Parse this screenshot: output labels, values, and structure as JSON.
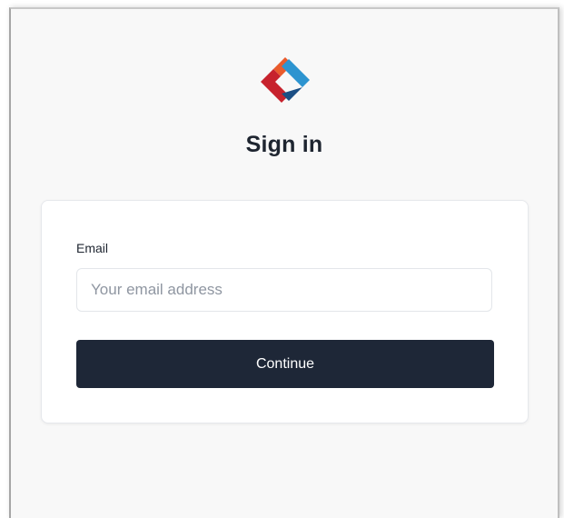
{
  "page": {
    "title": "Sign in"
  },
  "logo": {
    "icon": "brand-logo-icon",
    "colors": {
      "orange": "#e95b2c",
      "red": "#c7222d",
      "blue_light": "#2d94d0",
      "blue_dark": "#1b4f85"
    }
  },
  "form": {
    "email_label": "Email",
    "email_placeholder": "Your email address",
    "email_value": "",
    "continue_label": "Continue"
  },
  "colors": {
    "button_background": "#1e2737",
    "page_background": "#f8f8f8",
    "card_background": "#ffffff"
  }
}
